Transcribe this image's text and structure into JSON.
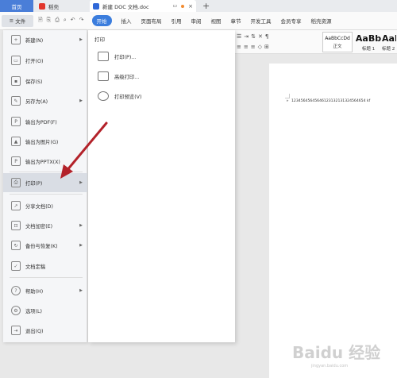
{
  "tabs": {
    "home": "首页",
    "shell": "稻壳",
    "doc": "新建 DOC 文档.doc"
  },
  "menubar": {
    "file": "文件",
    "start": "开始",
    "items": [
      "插入",
      "页面布局",
      "引用",
      "审阅",
      "视图",
      "章节",
      "开发工具",
      "会员专享",
      "稻壳资源"
    ]
  },
  "ribbon": {
    "styles": [
      {
        "sample": "AaBbCcDd",
        "name": "正文"
      },
      {
        "sample": "AaBb",
        "name": "标题 1"
      },
      {
        "sample": "AaB",
        "name": "标题 2"
      }
    ]
  },
  "filemenu": {
    "items": [
      {
        "label": "新建(N)",
        "icon": "new-doc-icon",
        "arrow": true
      },
      {
        "label": "打开(O)",
        "icon": "folder-icon",
        "arrow": false
      },
      {
        "label": "保存(S)",
        "icon": "save-icon",
        "arrow": false
      },
      {
        "label": "另存为(A)",
        "icon": "save-as-icon",
        "arrow": true
      },
      {
        "label": "输出为PDF(F)",
        "icon": "pdf-icon",
        "arrow": false
      },
      {
        "label": "输出为图片(G)",
        "icon": "image-icon",
        "arrow": false
      },
      {
        "label": "输出为PPTX(X)",
        "icon": "pptx-icon",
        "arrow": false
      },
      {
        "label": "打印(P)",
        "icon": "printer-icon",
        "arrow": true
      },
      {
        "label": "分享文档(D)",
        "icon": "share-icon",
        "arrow": false
      },
      {
        "label": "文档加密(E)",
        "icon": "lock-icon",
        "arrow": true
      },
      {
        "label": "备份与恢复(K)",
        "icon": "backup-icon",
        "arrow": true
      },
      {
        "label": "文档定稿",
        "icon": "finalize-icon",
        "arrow": false
      },
      {
        "label": "帮助(H)",
        "icon": "help-icon",
        "arrow": true
      },
      {
        "label": "选项(L)",
        "icon": "gear-icon",
        "arrow": false
      },
      {
        "label": "退出(Q)",
        "icon": "exit-icon",
        "arrow": false
      }
    ]
  },
  "submenu": {
    "title": "打印",
    "items": [
      {
        "label": "打印(P)...",
        "icon": "printer-icon"
      },
      {
        "label": "高级打印...",
        "icon": "advanced-print-icon"
      },
      {
        "label": "打印预览(V)",
        "icon": "print-preview-icon"
      }
    ]
  },
  "document": {
    "text": "12345645645646123132131324564654 kf"
  },
  "watermark": {
    "text": "Baidu 经验",
    "sub": "jingyan.baidu.com"
  }
}
